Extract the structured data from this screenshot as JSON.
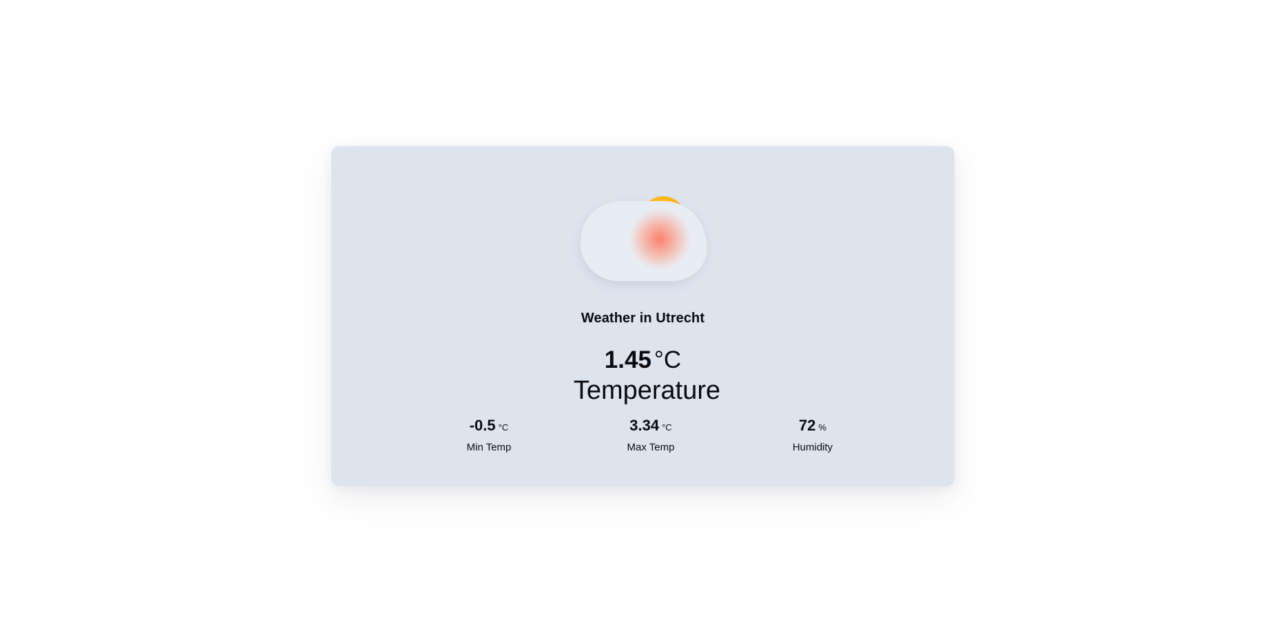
{
  "weather": {
    "city_title": "Weather in Utrecht",
    "icon": "partly-cloudy-icon",
    "temperature": {
      "value": "1.45",
      "unit": "°C",
      "label": "Temperature"
    },
    "stats": [
      {
        "value": "-0.5",
        "unit": "°C",
        "label": "Min Temp"
      },
      {
        "value": "3.34",
        "unit": "°C",
        "label": "Max Temp"
      },
      {
        "value": "72",
        "unit": "%",
        "label": "Humidity"
      }
    ]
  },
  "colors": {
    "page_background": "#ffffff",
    "card_background": "#dde4ee",
    "cloud": "#e8edf5",
    "sun": "#ffb21a",
    "sun_glow": "#ff7a66",
    "text": "#0b0b0f"
  }
}
